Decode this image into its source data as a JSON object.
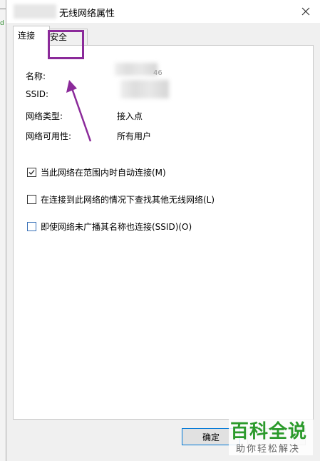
{
  "window": {
    "title": "无线网络属性",
    "close_icon": "close-icon"
  },
  "tabs": [
    {
      "label": "连接",
      "active": true
    },
    {
      "label": "安全",
      "active": false
    }
  ],
  "info": {
    "name_label": "名称:",
    "name_value_suffix": "46",
    "ssid_label": "SSID:",
    "type_label": "网络类型:",
    "type_value": "接入点",
    "availability_label": "网络可用性:",
    "availability_value": "所有用户"
  },
  "options": [
    {
      "label": "当此网络在范围内时自动连接(M)",
      "checked": true
    },
    {
      "label": "在连接到此网络的情况下查找其他无线网络(L)",
      "checked": false
    },
    {
      "label": "即使网络未广播其名称也连接(SSID)(O)",
      "checked": false
    }
  ],
  "buttons": {
    "ok": "确定"
  },
  "watermark": {
    "title": "百科全说",
    "subtitle": "助你轻松解决"
  },
  "colors": {
    "annotation": "#8b2a9a",
    "watermark": "#2b9a2b",
    "accent": "#0078d7"
  }
}
